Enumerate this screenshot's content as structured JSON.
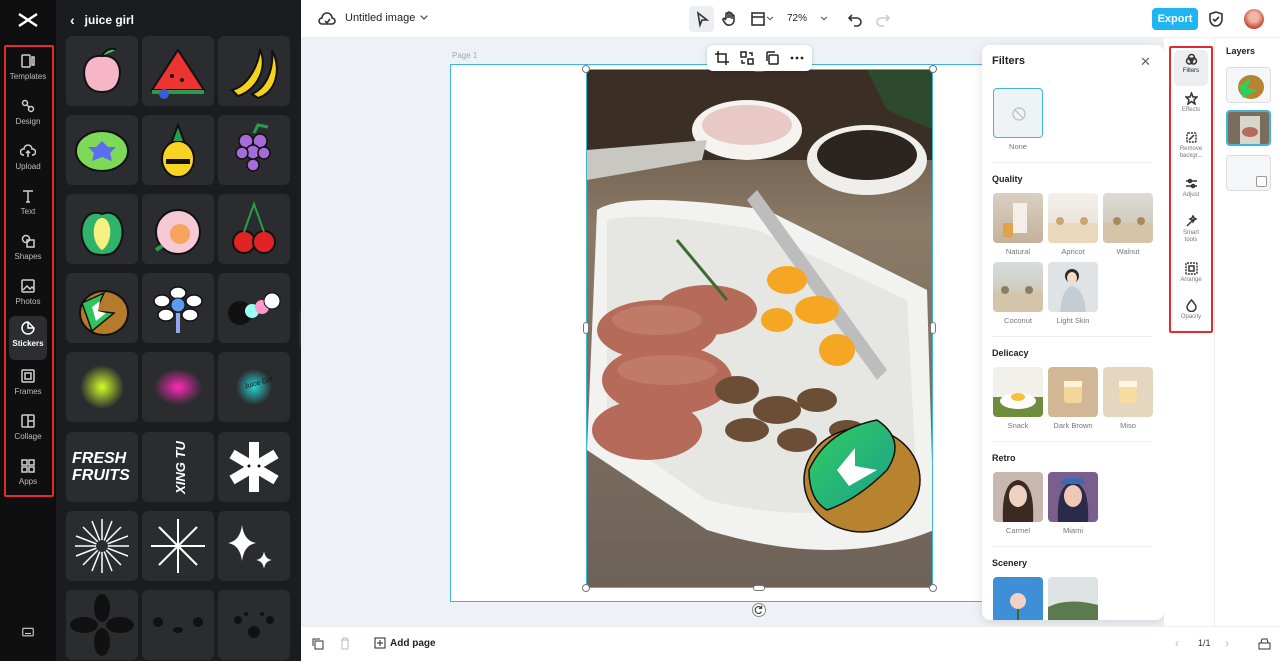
{
  "app": {
    "document_title": "Untitled image",
    "zoom": "72%",
    "export_label": "Export",
    "page_label": "Page 1"
  },
  "rail": {
    "items": [
      {
        "label": "Templates",
        "icon": "templates-icon"
      },
      {
        "label": "Design",
        "icon": "design-icon"
      },
      {
        "label": "Upload",
        "icon": "upload-icon"
      },
      {
        "label": "Text",
        "icon": "text-icon"
      },
      {
        "label": "Shapes",
        "icon": "shapes-icon"
      },
      {
        "label": "Photos",
        "icon": "photos-icon"
      },
      {
        "label": "Stickers",
        "icon": "stickers-icon"
      },
      {
        "label": "Frames",
        "icon": "frames-icon"
      },
      {
        "label": "Collage",
        "icon": "collage-icon"
      },
      {
        "label": "Apps",
        "icon": "apps-icon"
      }
    ],
    "active": "Stickers"
  },
  "stickers": {
    "title": "juice girl",
    "text_stickers": [
      "FRESH",
      "FRUITS",
      "XING TU",
      "Juice Girl"
    ]
  },
  "filters": {
    "title": "Filters",
    "none_label": "None",
    "sections": [
      {
        "name": "Quality",
        "items": [
          "Natural",
          "Apricot",
          "Walnut",
          "Coconut",
          "Light Skin"
        ]
      },
      {
        "name": "Delicacy",
        "items": [
          "Snack",
          "Dark Brown",
          "Miso"
        ]
      },
      {
        "name": "Retro",
        "items": [
          "Carmel",
          "Miami"
        ]
      },
      {
        "name": "Scenery",
        "items": []
      }
    ]
  },
  "tools": [
    {
      "label": "Filters",
      "icon": "filters-icon"
    },
    {
      "label": "Effects",
      "icon": "effects-icon"
    },
    {
      "label": "Remove backgr...",
      "icon": "remove-background-icon"
    },
    {
      "label": "Adjust",
      "icon": "adjust-icon"
    },
    {
      "label": "Smart tools",
      "icon": "smart-tools-icon"
    },
    {
      "label": "Arrange",
      "icon": "arrange-icon"
    },
    {
      "label": "Opacity",
      "icon": "opacity-icon"
    }
  ],
  "layers": {
    "title": "Layers"
  },
  "bottom": {
    "add_page": "Add page",
    "page_counter": "1/1"
  },
  "colors": {
    "accent": "#1fb5f0",
    "highlight": "#e32b2b",
    "selection": "#3fb6d8"
  }
}
